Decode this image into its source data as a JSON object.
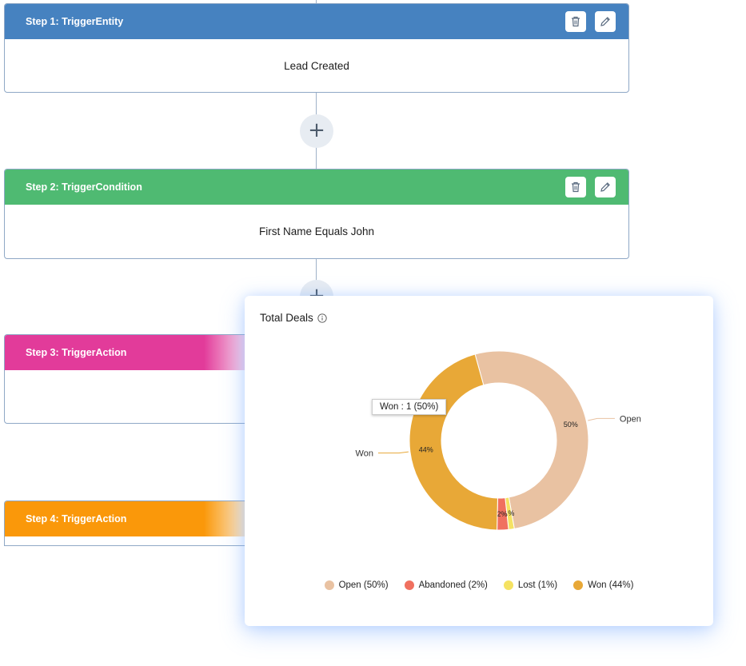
{
  "steps": [
    {
      "header": "Step 1: TriggerEntity",
      "body": "Lead Created",
      "color": "#4682c0"
    },
    {
      "header": "Step 2: TriggerCondition",
      "body": "First Name Equals John",
      "color": "#4fba72"
    },
    {
      "header": "Step 3: TriggerAction",
      "body": "",
      "color": "#e23b9a"
    },
    {
      "header": "Step 4: TriggerAction",
      "body": "",
      "color": "#fa980a"
    }
  ],
  "icons": {
    "delete": "trash-icon",
    "edit": "pencil-icon",
    "add": "plus-icon",
    "info": "info-icon"
  },
  "add_label": "+",
  "chart": {
    "title": "Total Deals",
    "tooltip": "Won : 1 (50%)",
    "legend": [
      "Open (50%)",
      "Abandoned (2%)",
      "Lost (1%)",
      "Won (44%)"
    ]
  },
  "chart_data": {
    "type": "pie",
    "donut": true,
    "title": "Total Deals",
    "categories": [
      "Open",
      "Lost",
      "Abandoned",
      "Won"
    ],
    "values": [
      50,
      1,
      2,
      44
    ],
    "data_labels": [
      "50%",
      "1%",
      "2%",
      "44%"
    ],
    "colors": [
      "#e9c2a2",
      "#f5e262",
      "#f0705f",
      "#e8a837"
    ],
    "legend_position": "bottom"
  }
}
